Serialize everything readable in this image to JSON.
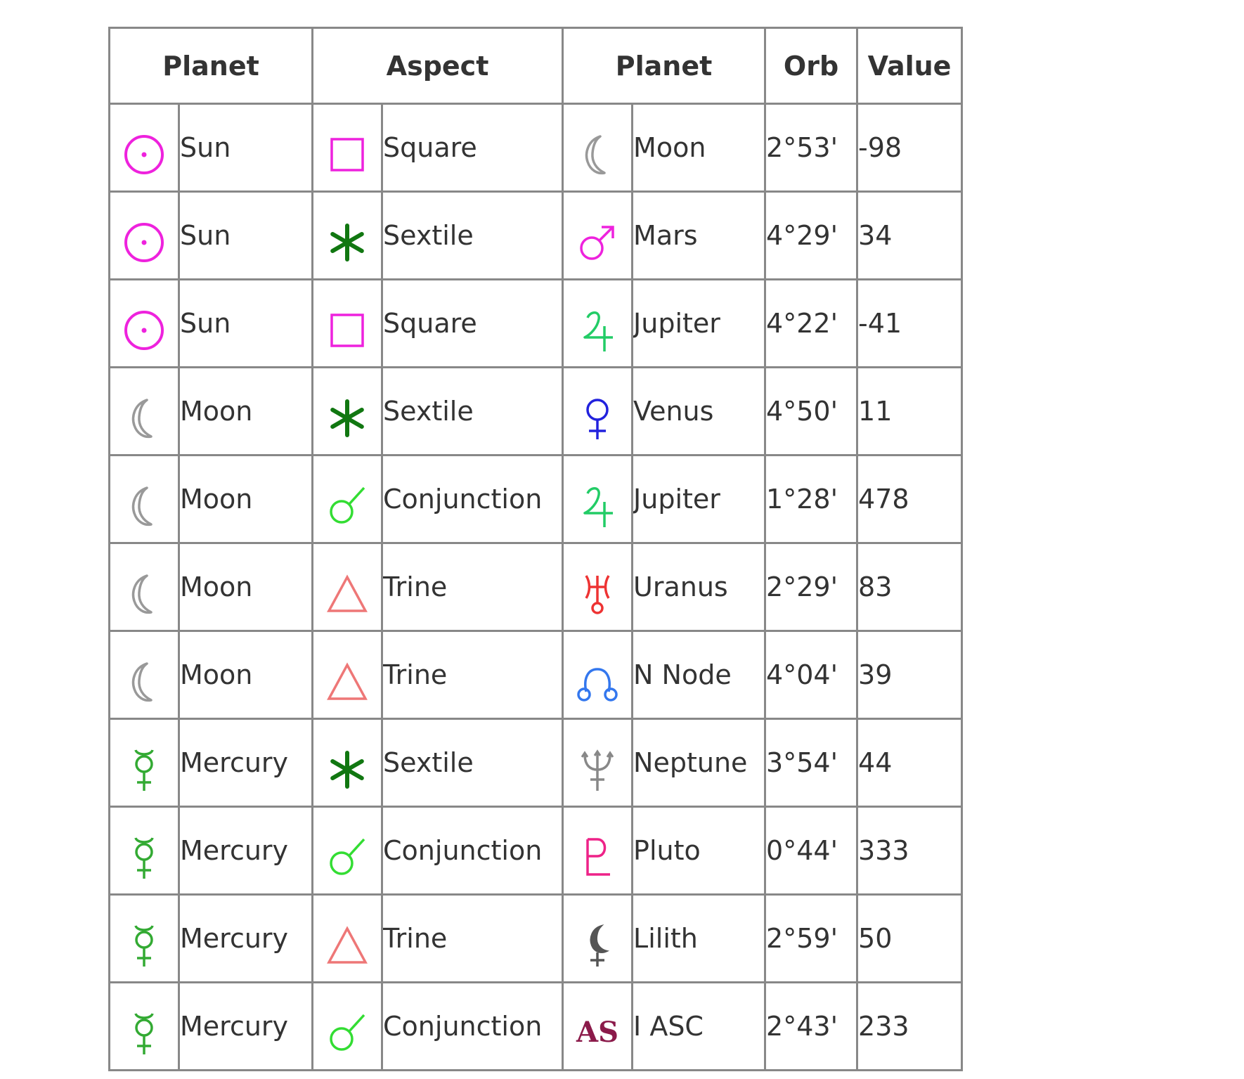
{
  "table": {
    "headers": {
      "planet1": "Planet",
      "aspect": "Aspect",
      "planet2": "Planet",
      "orb": "Orb",
      "value": "Value"
    },
    "rows": [
      {
        "p1": "Sun",
        "p1_icon": "sun-icon",
        "aspect": "Square",
        "aspect_icon": "square-aspect-icon",
        "p2": "Moon",
        "p2_icon": "moon-icon",
        "orb": "2°53'",
        "value": "-98"
      },
      {
        "p1": "Sun",
        "p1_icon": "sun-icon",
        "aspect": "Sextile",
        "aspect_icon": "sextile-aspect-icon",
        "p2": "Mars",
        "p2_icon": "mars-icon",
        "orb": "4°29'",
        "value": "34"
      },
      {
        "p1": "Sun",
        "p1_icon": "sun-icon",
        "aspect": "Square",
        "aspect_icon": "square-aspect-icon",
        "p2": "Jupiter",
        "p2_icon": "jupiter-icon",
        "orb": "4°22'",
        "value": "-41"
      },
      {
        "p1": "Moon",
        "p1_icon": "moon-icon",
        "aspect": "Sextile",
        "aspect_icon": "sextile-aspect-icon",
        "p2": "Venus",
        "p2_icon": "venus-icon",
        "orb": "4°50'",
        "value": "11"
      },
      {
        "p1": "Moon",
        "p1_icon": "moon-icon",
        "aspect": "Conjunction",
        "aspect_icon": "conjunction-aspect-icon",
        "p2": "Jupiter",
        "p2_icon": "jupiter-icon",
        "orb": "1°28'",
        "value": "478"
      },
      {
        "p1": "Moon",
        "p1_icon": "moon-icon",
        "aspect": "Trine",
        "aspect_icon": "trine-aspect-icon",
        "p2": "Uranus",
        "p2_icon": "uranus-icon",
        "orb": "2°29'",
        "value": "83"
      },
      {
        "p1": "Moon",
        "p1_icon": "moon-icon",
        "aspect": "Trine",
        "aspect_icon": "trine-aspect-icon",
        "p2": "N Node",
        "p2_icon": "north-node-icon",
        "orb": "4°04'",
        "value": "39"
      },
      {
        "p1": "Mercury",
        "p1_icon": "mercury-icon",
        "aspect": "Sextile",
        "aspect_icon": "sextile-aspect-icon",
        "p2": "Neptune",
        "p2_icon": "neptune-icon",
        "orb": "3°54'",
        "value": "44"
      },
      {
        "p1": "Mercury",
        "p1_icon": "mercury-icon",
        "aspect": "Conjunction",
        "aspect_icon": "conjunction-aspect-icon",
        "p2": "Pluto",
        "p2_icon": "pluto-icon",
        "orb": "0°44'",
        "value": "333"
      },
      {
        "p1": "Mercury",
        "p1_icon": "mercury-icon",
        "aspect": "Trine",
        "aspect_icon": "trine-aspect-icon",
        "p2": "Lilith",
        "p2_icon": "lilith-icon",
        "orb": "2°59'",
        "value": "50"
      },
      {
        "p1": "Mercury",
        "p1_icon": "mercury-icon",
        "aspect": "Conjunction",
        "aspect_icon": "conjunction-aspect-icon",
        "p2": "I ASC",
        "p2_icon": "ascendant-icon",
        "p2_icon_text": "AS",
        "orb": "2°43'",
        "value": "233"
      }
    ]
  },
  "colors": {
    "sun": "#ee22dd",
    "moon": "#999999",
    "mercury": "#33aa33",
    "venus": "#2222dd",
    "mars": "#ee22dd",
    "jupiter": "#22cc66",
    "uranus": "#ee3333",
    "north_node": "#3377ee",
    "neptune": "#888888",
    "pluto": "#ee2288",
    "lilith": "#555555",
    "ascendant": "#8b1a4a",
    "square": "#ee22dd",
    "sextile": "#117711",
    "conjunction": "#33dd33",
    "trine": "#ee7777",
    "border": "#888888"
  }
}
